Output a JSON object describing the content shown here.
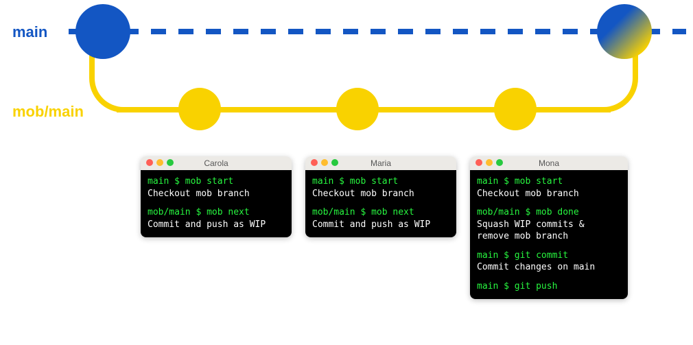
{
  "branches": {
    "main": "main",
    "mob": "mob/main"
  },
  "colors": {
    "main": "#1356c3",
    "mob": "#f9d200",
    "cmd": "#27f53f"
  },
  "terminals": [
    {
      "title": "Carola",
      "blocks": [
        {
          "cmd": "main $ mob start",
          "desc": "Checkout mob branch"
        },
        {
          "cmd": "mob/main $ mob next",
          "desc": "Commit and push as WIP"
        }
      ]
    },
    {
      "title": "Maria",
      "blocks": [
        {
          "cmd": "main $ mob start",
          "desc": "Checkout mob branch"
        },
        {
          "cmd": "mob/main $ mob next",
          "desc": "Commit and push as WIP"
        }
      ]
    },
    {
      "title": "Mona",
      "blocks": [
        {
          "cmd": "main $ mob start",
          "desc": "Checkout mob branch"
        },
        {
          "cmd": "mob/main $ mob done",
          "desc": "Squash WIP commits & remove mob branch"
        },
        {
          "cmd": "main $ git commit",
          "desc": "Commit changes on main"
        },
        {
          "cmd": "main $ git push",
          "desc": ""
        }
      ]
    }
  ]
}
